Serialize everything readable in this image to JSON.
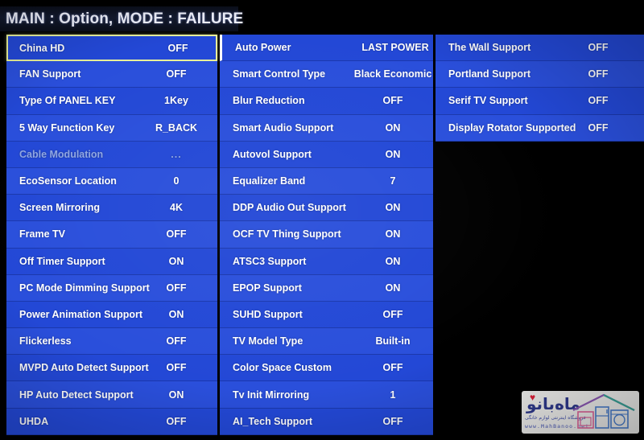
{
  "header": {
    "title": "MAIN : Option, MODE : FAILURE"
  },
  "theme": {
    "row_blue": "#2348d6",
    "row_blue_alt": "#2a4fdb",
    "separator": "#1b38ac",
    "selection_border": "#e8f09a",
    "text": "#ffffff",
    "dim_text": "#8fa6e2",
    "background": "#000000"
  },
  "menu": {
    "columns": [
      {
        "name": "column-1",
        "rows": [
          {
            "label": "China HD",
            "value": "OFF",
            "selected": true,
            "dim": false
          },
          {
            "label": "FAN Support",
            "value": "OFF",
            "selected": false,
            "dim": false
          },
          {
            "label": "Type Of PANEL KEY",
            "value": "1Key",
            "selected": false,
            "dim": false
          },
          {
            "label": "5 Way Function Key",
            "value": "R_BACK",
            "selected": false,
            "dim": false
          },
          {
            "label": "Cable Modulation",
            "value": "...",
            "selected": false,
            "dim": true
          },
          {
            "label": "EcoSensor Location",
            "value": "0",
            "selected": false,
            "dim": false
          },
          {
            "label": "Screen Mirroring",
            "value": "4K",
            "selected": false,
            "dim": false
          },
          {
            "label": "Frame TV",
            "value": "OFF",
            "selected": false,
            "dim": false
          },
          {
            "label": "Off Timer Support",
            "value": "ON",
            "selected": false,
            "dim": false
          },
          {
            "label": "PC Mode Dimming Support",
            "value": "OFF",
            "selected": false,
            "dim": false
          },
          {
            "label": "Power Animation Support",
            "value": "ON",
            "selected": false,
            "dim": false
          },
          {
            "label": "Flickerless",
            "value": "OFF",
            "selected": false,
            "dim": false
          },
          {
            "label": "MVPD Auto Detect Support",
            "value": "OFF",
            "selected": false,
            "dim": false
          },
          {
            "label": "HP Auto Detect Support",
            "value": "ON",
            "selected": false,
            "dim": false
          },
          {
            "label": "UHDA",
            "value": "OFF",
            "selected": false,
            "dim": false
          }
        ]
      },
      {
        "name": "column-2",
        "rows": [
          {
            "label": "Auto Power",
            "value": "LAST POWER",
            "selected": false,
            "dim": false
          },
          {
            "label": "Smart Control Type",
            "value": "Black Economic",
            "selected": false,
            "dim": false
          },
          {
            "label": "Blur Reduction",
            "value": "OFF",
            "selected": false,
            "dim": false
          },
          {
            "label": "Smart Audio Support",
            "value": "ON",
            "selected": false,
            "dim": false
          },
          {
            "label": "Autovol Support",
            "value": "ON",
            "selected": false,
            "dim": false
          },
          {
            "label": "Equalizer Band",
            "value": "7",
            "selected": false,
            "dim": false
          },
          {
            "label": "DDP Audio Out Support",
            "value": "ON",
            "selected": false,
            "dim": false
          },
          {
            "label": "OCF TV Thing Support",
            "value": "ON",
            "selected": false,
            "dim": false
          },
          {
            "label": "ATSC3 Support",
            "value": "ON",
            "selected": false,
            "dim": false
          },
          {
            "label": "EPOP Support",
            "value": "ON",
            "selected": false,
            "dim": false
          },
          {
            "label": "SUHD Support",
            "value": "OFF",
            "selected": false,
            "dim": false
          },
          {
            "label": "TV Model Type",
            "value": "Built-in",
            "selected": false,
            "dim": false
          },
          {
            "label": "Color Space Custom",
            "value": "OFF",
            "selected": false,
            "dim": false
          },
          {
            "label": "Tv Init Mirroring",
            "value": "1",
            "selected": false,
            "dim": false
          },
          {
            "label": "AI_Tech Support",
            "value": "OFF",
            "selected": false,
            "dim": false
          }
        ]
      },
      {
        "name": "column-3",
        "rows": [
          {
            "label": "The Wall Support",
            "value": "OFF",
            "selected": false,
            "dim": false
          },
          {
            "label": "Portland Support",
            "value": "OFF",
            "selected": false,
            "dim": false
          },
          {
            "label": "Serif TV Support",
            "value": "OFF",
            "selected": false,
            "dim": false
          },
          {
            "label": "Display Rotator Supported",
            "value": "OFF",
            "selected": false,
            "dim": false
          }
        ]
      }
    ]
  },
  "watermark": {
    "brand": "ماه‌بانو",
    "heart": "♥",
    "subtitle": "فروشگاه اینترنتی لوازم خانگی",
    "url": "www.MahBanoo.net"
  }
}
